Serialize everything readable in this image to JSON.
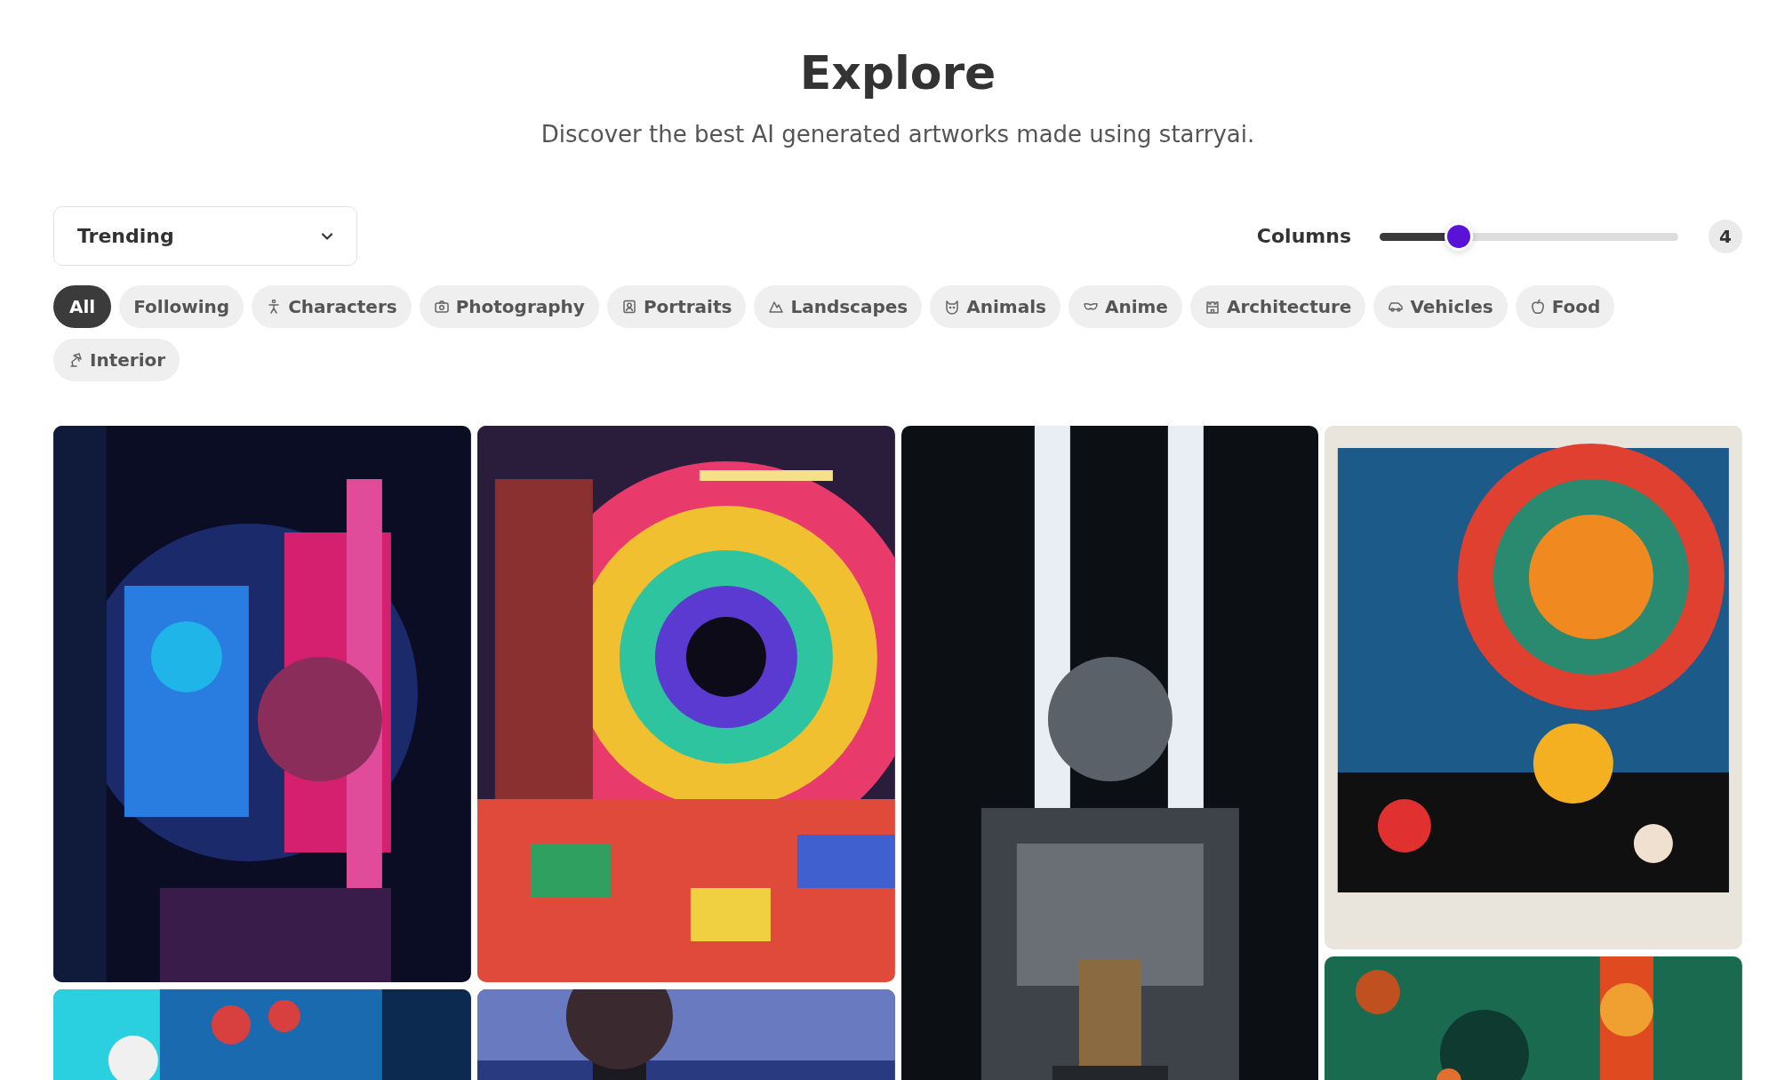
{
  "header": {
    "title": "Explore",
    "subtitle": "Discover the best AI generated artworks made using starryai."
  },
  "sort_dropdown": {
    "value": "Trending"
  },
  "columns_slider": {
    "label": "Columns",
    "level": 0.23,
    "value": "4"
  },
  "categories": [
    {
      "label": "All",
      "selected": true
    },
    {
      "label": "Following",
      "selected": false
    },
    {
      "label": "Characters",
      "selected": false
    },
    {
      "label": "Photography",
      "selected": false
    },
    {
      "label": "Portraits",
      "selected": false
    },
    {
      "label": "Landscapes",
      "selected": false
    },
    {
      "label": "Animals",
      "selected": false
    },
    {
      "label": "Anime",
      "selected": false
    },
    {
      "label": "Architecture",
      "selected": false
    },
    {
      "label": "Vehicles",
      "selected": false
    },
    {
      "label": "Food",
      "selected": false
    },
    {
      "label": "Interior",
      "selected": false
    }
  ]
}
